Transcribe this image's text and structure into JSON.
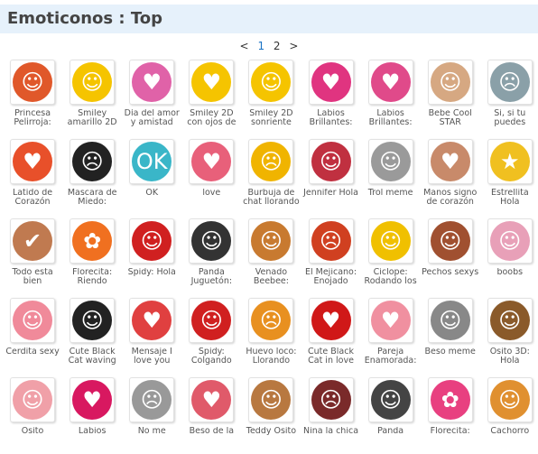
{
  "page": {
    "title": "Emoticonos : Top",
    "pager": {
      "prev": "<",
      "pages": [
        "1",
        "2"
      ],
      "current": "1",
      "next": ">"
    }
  },
  "emoticons": [
    {
      "name": "Princesa Pelirroja:",
      "icon": "redhead-princess-icon",
      "glyph": "☺",
      "color": "#e0582a"
    },
    {
      "name": "Smiley amarillo 2D",
      "icon": "laughing-smiley-icon",
      "glyph": "☺",
      "color": "#f5c400"
    },
    {
      "name": "Día del amor y amistad",
      "icon": "pink-lips-icon",
      "glyph": "♥",
      "color": "#e062a8"
    },
    {
      "name": "Smiley 2D con ojos de",
      "icon": "heart-eyes-smiley-icon",
      "glyph": "♥",
      "color": "#f5c400"
    },
    {
      "name": "Smiley 2D sonriente",
      "icon": "smirk-smiley-icon",
      "glyph": "☺",
      "color": "#f5c400"
    },
    {
      "name": "Labios Brillantes:",
      "icon": "shiny-lips-icon",
      "glyph": "♥",
      "color": "#e03480"
    },
    {
      "name": "Labios Brillantes:",
      "icon": "tongue-lips-icon",
      "glyph": "♥",
      "color": "#e04a8a"
    },
    {
      "name": "Bebe Cool STAR",
      "icon": "cool-baby-icon",
      "glyph": "☺",
      "color": "#d6a882"
    },
    {
      "name": "Si, si tu puedes",
      "icon": "crying-meme-icon",
      "glyph": "☹",
      "color": "#8aa0a8"
    },
    {
      "name": "Latido de Corazón",
      "icon": "beating-heart-icon",
      "glyph": "♥",
      "color": "#e8502a"
    },
    {
      "name": "Mascara de Miedo:",
      "icon": "scream-mask-icon",
      "glyph": "☹",
      "color": "#222222"
    },
    {
      "name": "OK",
      "icon": "ok-sign-icon",
      "glyph": "OK",
      "color": "#3ab6c8"
    },
    {
      "name": "love",
      "icon": "love-hearts-icon",
      "glyph": "♥",
      "color": "#e8607a"
    },
    {
      "name": "Burbuja de chat llorando",
      "icon": "crying-bubble-icon",
      "glyph": "☹",
      "color": "#f0b400"
    },
    {
      "name": "Jennifer Hola",
      "icon": "jennifer-waving-icon",
      "glyph": "☺",
      "color": "#c03040"
    },
    {
      "name": "Trol meme",
      "icon": "troll-face-icon",
      "glyph": "☺",
      "color": "#9a9a9a"
    },
    {
      "name": "Manos signo de corazón",
      "icon": "heart-hands-icon",
      "glyph": "♥",
      "color": "#c88a6a"
    },
    {
      "name": "Estrellita Hola",
      "icon": "waving-star-icon",
      "glyph": "★",
      "color": "#f0c020"
    },
    {
      "name": "Todo esta bien",
      "icon": "thumbs-up-icon",
      "glyph": "✔",
      "color": "#c07a50"
    },
    {
      "name": "Florecita: Riendo",
      "icon": "laughing-flower-icon",
      "glyph": "✿",
      "color": "#f07020"
    },
    {
      "name": "Spidy: Hola",
      "icon": "spiderman-icon",
      "glyph": "☺",
      "color": "#d02020"
    },
    {
      "name": "Panda Juguetón:",
      "icon": "playful-panda-icon",
      "glyph": "☺",
      "color": "#333333"
    },
    {
      "name": "Venado Beebee:",
      "icon": "deer-icon",
      "glyph": "☺",
      "color": "#c87a30"
    },
    {
      "name": "El Mejicano: Enojado",
      "icon": "angry-mexican-icon",
      "glyph": "☹",
      "color": "#d04020"
    },
    {
      "name": "Ciclope: Rodando los",
      "icon": "cyclops-icon",
      "glyph": "☺",
      "color": "#f0c000"
    },
    {
      "name": "Pechos sexys",
      "icon": "sexy-chest-icon",
      "glyph": "☺",
      "color": "#a05030"
    },
    {
      "name": "boobs",
      "icon": "anime-girl-icon",
      "glyph": "☺",
      "color": "#e8a0b8"
    },
    {
      "name": "Cerdita sexy",
      "icon": "sexy-piggy-icon",
      "glyph": "☺",
      "color": "#f08a9a"
    },
    {
      "name": "Cute Black Cat waving",
      "icon": "black-cat-waving-icon",
      "glyph": "☺",
      "color": "#222222"
    },
    {
      "name": "Mensaje I love you",
      "icon": "i-love-you-icon",
      "glyph": "♥",
      "color": "#e04040"
    },
    {
      "name": "Spidy: Colgando",
      "icon": "hanging-spiderman-icon",
      "glyph": "☺",
      "color": "#d02020"
    },
    {
      "name": "Huevo loco: Llorando",
      "icon": "crying-egg-icon",
      "glyph": "☹",
      "color": "#e89020"
    },
    {
      "name": "Cute Black Cat in love",
      "icon": "black-cat-love-icon",
      "glyph": "♥",
      "color": "#d01818"
    },
    {
      "name": "Pareja Enamorada:",
      "icon": "couple-in-love-icon",
      "glyph": "♥",
      "color": "#f090a0"
    },
    {
      "name": "Beso meme",
      "icon": "kiss-meme-icon",
      "glyph": "☺",
      "color": "#888888"
    },
    {
      "name": "Osito 3D: Hola",
      "icon": "teddy-bear-3d-icon",
      "glyph": "☺",
      "color": "#8a5a2a"
    },
    {
      "name": "Osito",
      "icon": "pink-teddy-icon",
      "glyph": "☺",
      "color": "#f0a0a8"
    },
    {
      "name": "Labios",
      "icon": "red-lips-icon",
      "glyph": "♥",
      "color": "#d81860"
    },
    {
      "name": "No me",
      "icon": "no-me-meme-icon",
      "glyph": "☹",
      "color": "#999999"
    },
    {
      "name": "Beso de la",
      "icon": "kissing-couple-icon",
      "glyph": "♥",
      "color": "#e05a6a"
    },
    {
      "name": "Teddy Osito",
      "icon": "teddy-icon",
      "glyph": "☺",
      "color": "#b87840"
    },
    {
      "name": "Nina la chica",
      "icon": "nina-girl-icon",
      "glyph": "☹",
      "color": "#7a2a2a"
    },
    {
      "name": "Panda",
      "icon": "panda-icon",
      "glyph": "☺",
      "color": "#444444"
    },
    {
      "name": "Florecita:",
      "icon": "flower-icon",
      "glyph": "✿",
      "color": "#e84080"
    },
    {
      "name": "Cachorro",
      "icon": "puppy-icon",
      "glyph": "☺",
      "color": "#e09030"
    }
  ]
}
